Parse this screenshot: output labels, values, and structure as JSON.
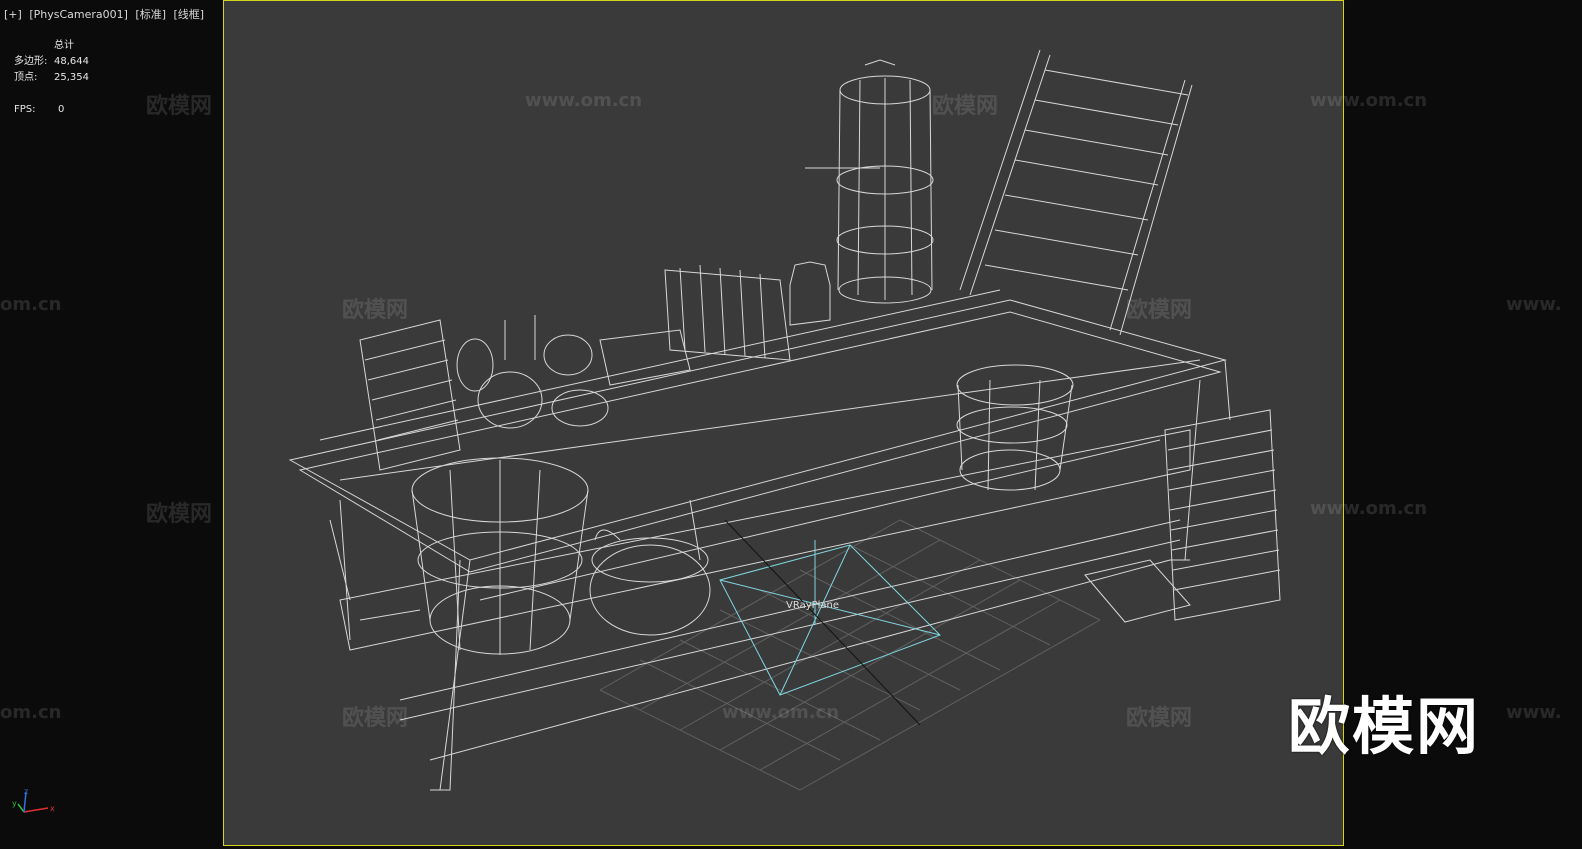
{
  "viewport": {
    "menu": "[+]",
    "camera": "[PhysCamera001]",
    "shading_mode": "[标准]",
    "display_mode": "[线框]"
  },
  "stats": {
    "header": "总计",
    "polygons_label": "多边形:",
    "polygons_value": "48,644",
    "vertices_label": "顶点:",
    "vertices_value": "25,354",
    "fps_label": "FPS:",
    "fps_value": "0"
  },
  "scene": {
    "object_label": "VRayPlane"
  },
  "watermark": {
    "brand_cn": "欧模网",
    "site": "www.om.cn",
    "site_short": "om.cn",
    "site_prefix": "www."
  },
  "axis": {
    "x": "x",
    "y": "y",
    "z": "z"
  },
  "colors": {
    "viewport_bg": "#3a3a3a",
    "frame_border": "#d4d41a",
    "wire": "#e8e8e8",
    "vray_plane": "#7fd6e0"
  }
}
